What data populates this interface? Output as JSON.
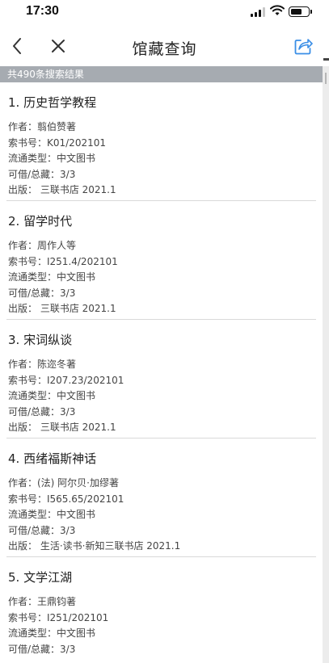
{
  "status_bar": {
    "time": "17:30",
    "battery_level": 0.55
  },
  "nav": {
    "title": "馆藏查询",
    "icons": [
      "back-icon",
      "close-icon",
      "share-icon"
    ]
  },
  "result_count_text": "共490条搜索结果",
  "books": [
    {
      "title": "1. 历史哲学教程",
      "author": "作者：翦伯赞著",
      "call_number": "索书号：K01/202101",
      "circulation_type": "流通类型：中文图书",
      "availability": "可借/总藏：3/3",
      "publisher": "出版：  三联书店 2021.1"
    },
    {
      "title": "2. 留学时代",
      "author": "作者：周作人等",
      "call_number": "索书号：I251.4/202101",
      "circulation_type": "流通类型：中文图书",
      "availability": "可借/总藏：3/3",
      "publisher": "出版：  三联书店 2021.1"
    },
    {
      "title": "3. 宋词纵谈",
      "author": "作者：陈迩冬著",
      "call_number": "索书号：I207.23/202101",
      "circulation_type": "流通类型：中文图书",
      "availability": "可借/总藏：3/3",
      "publisher": "出版：  三联书店 2021.1"
    },
    {
      "title": "4. 西绪福斯神话",
      "author": "作者：(法) 阿尔贝·加缪著",
      "call_number": "索书号：I565.65/202101",
      "circulation_type": "流通类型：中文图书",
      "availability": "可借/总藏：3/3",
      "publisher": "出版：  生活·读书·新知三联书店 2021.1"
    },
    {
      "title": "5. 文学江湖",
      "author": "作者：王鼎钧著",
      "call_number": "索书号：I251/202101",
      "circulation_type": "流通类型：中文图书",
      "availability": "可借/总藏：3/3"
    }
  ]
}
